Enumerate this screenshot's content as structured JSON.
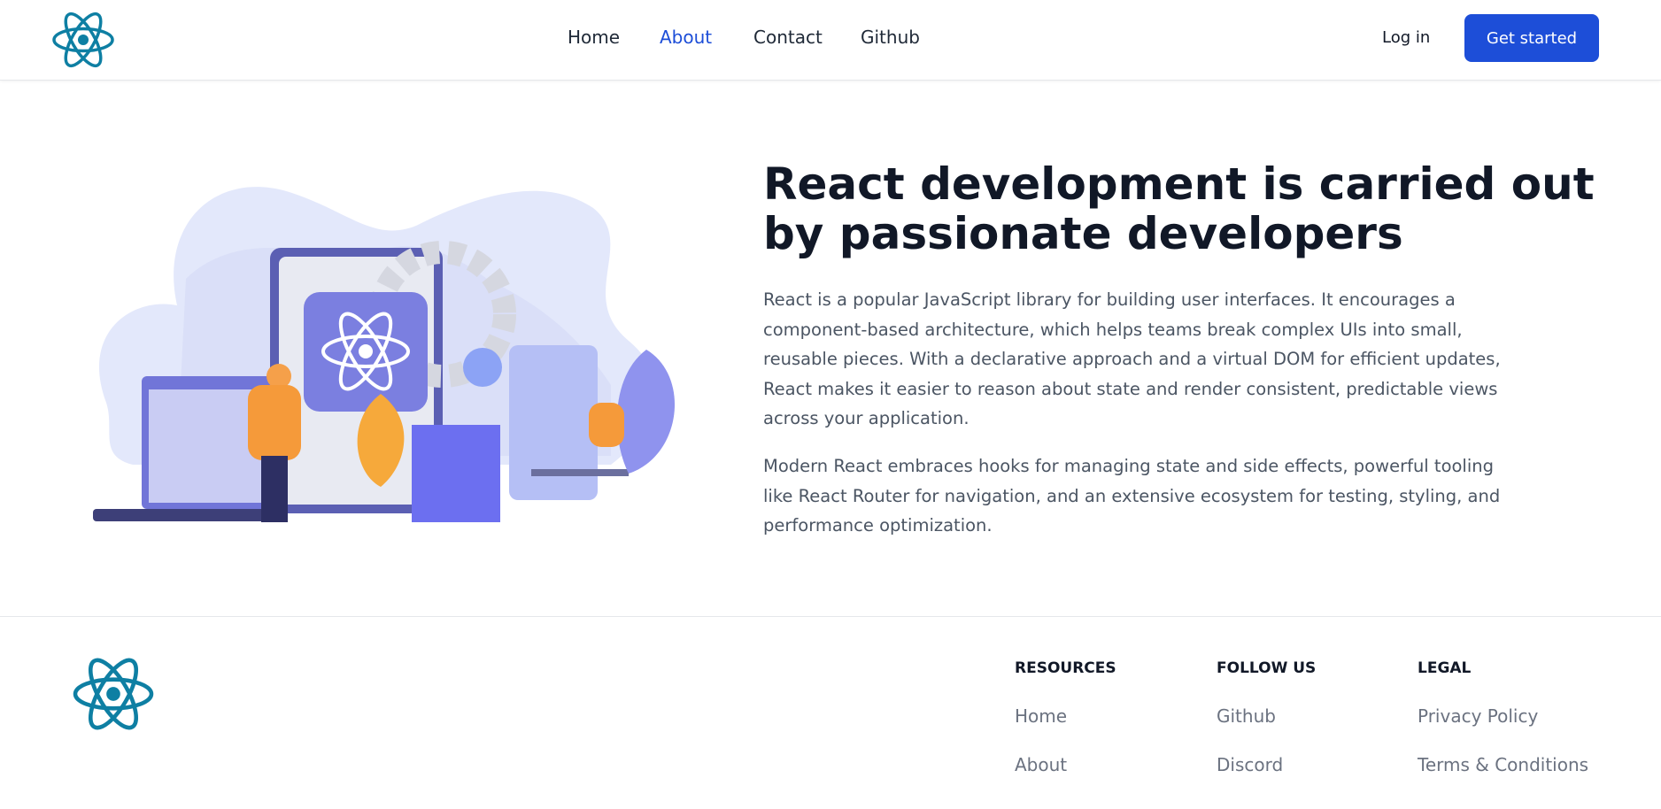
{
  "header": {
    "logo": "react-logo",
    "nav": [
      {
        "label": "Home"
      },
      {
        "label": "About",
        "active": true
      },
      {
        "label": "Contact"
      },
      {
        "label": "Github"
      }
    ],
    "login": "Log in",
    "get_started": "Get started",
    "accent": "#1d4ed8"
  },
  "hero": {
    "title": "React development is carried out by passionate developers",
    "paragraphs": [
      "React is a popular JavaScript library for building user interfaces. It encourages a component-based architecture, which helps teams break complex UIs into small, reusable pieces. With a declarative approach and a virtual DOM for efficient updates, React makes it easier to reason about state and render consistent, predictable views across your application.",
      "Modern React embraces hooks for managing state and side effects, powerful tooling like React Router for navigation, and an extensive ecosystem for testing, styling, and performance optimization."
    ]
  },
  "footer": {
    "columns": [
      {
        "title": "RESOURCES",
        "links": [
          "Home",
          "About"
        ]
      },
      {
        "title": "FOLLOW US",
        "links": [
          "Github",
          "Discord"
        ]
      },
      {
        "title": "LEGAL",
        "links": [
          "Privacy Policy",
          "Terms & Conditions"
        ]
      }
    ]
  }
}
